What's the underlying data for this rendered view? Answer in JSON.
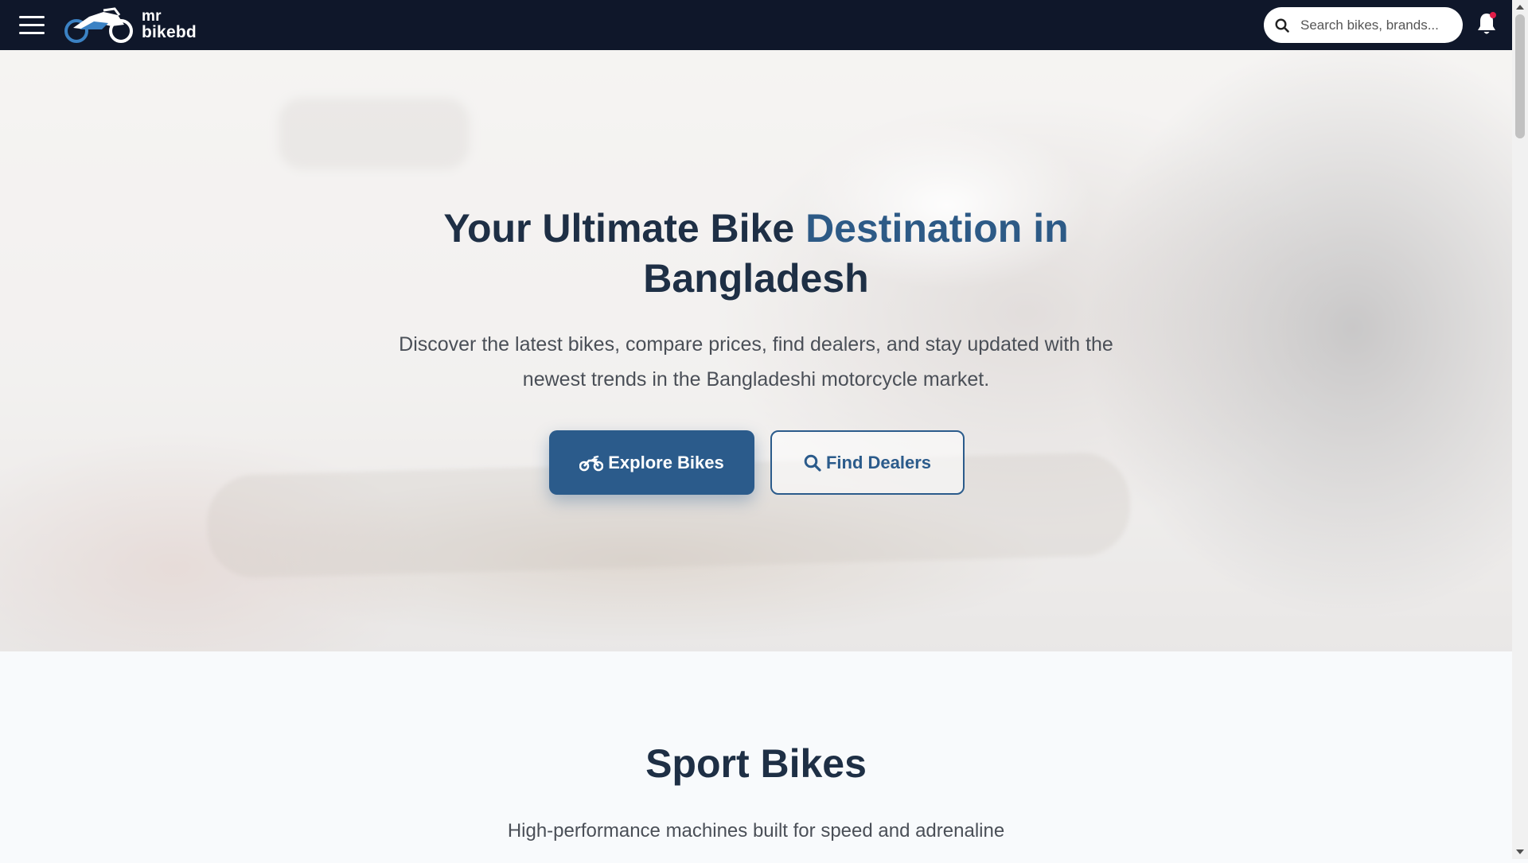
{
  "navbar": {
    "menu_icon": "hamburger-menu-icon",
    "logo_line1": "mr",
    "logo_line2": "bikebd",
    "search_placeholder": "Search bikes, brands...",
    "search_icon": "search-icon",
    "notification_icon": "bell-icon"
  },
  "hero": {
    "title_part1": "Your Ultimate Bike ",
    "title_part2": "Destination in",
    "title_part3": "Bangladesh",
    "subtitle": "Discover the latest bikes, compare prices, find dealers, and stay updated with the newest trends in the Bangladeshi motorcycle market.",
    "primary_button": "Explore Bikes",
    "secondary_button": "Find Dealers"
  },
  "section": {
    "title": "Sport Bikes",
    "subtitle": "High-performance machines built for speed and adrenaline"
  },
  "colors": {
    "navbar": "#0f172a",
    "primary": "#2b5b8b",
    "heading": "#1e2f45",
    "notification_dot": "#e11d48"
  }
}
